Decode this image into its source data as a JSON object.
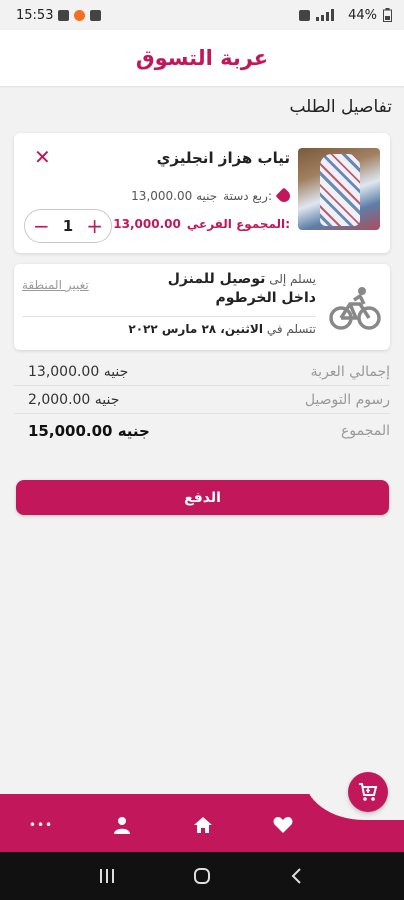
{
  "status_bar": {
    "time": "15:53",
    "battery": "44%"
  },
  "header": {
    "title": "عربة التسوق"
  },
  "section_title": "تفاصيل الطلب",
  "cart_item": {
    "name": "تياب هزاز انجليزي",
    "price_label": "ربع دستة:",
    "price_value": "13,000.00 جنيه",
    "subtotal_label": "المجموع الفرعي:",
    "subtotal_value": "13,000.00",
    "quantity": "1"
  },
  "delivery": {
    "prefix": "يسلم إلى",
    "destination": "توصيل للمنزل داخل الخرطوم",
    "change_area": "تغيير المنطقة",
    "receive_prefix": "تتسلم في",
    "receive_date": "الاثنين، ٢٨ مارس ٢٠٢٢"
  },
  "totals": {
    "cart_total_label": "إجمالي العربة",
    "cart_total_value": "13,000.00 جنيه",
    "delivery_fee_label": "رسوم التوصيل",
    "delivery_fee_value": "2,000.00 جنيه",
    "grand_total_label": "المجموع",
    "grand_total_value": "15,000.00 جنيه"
  },
  "pay_button": "الدفع",
  "bottom_nav": {
    "items": [
      {
        "icon": "more-dots-icon",
        "glyph": "•••"
      },
      {
        "icon": "user-icon",
        "glyph": ""
      },
      {
        "icon": "home-icon",
        "glyph": ""
      },
      {
        "icon": "heart-icon",
        "glyph": ""
      }
    ],
    "fab_icon": "cart-icon"
  },
  "colors": {
    "accent": "#c2185b",
    "background": "#f2f2f2"
  }
}
